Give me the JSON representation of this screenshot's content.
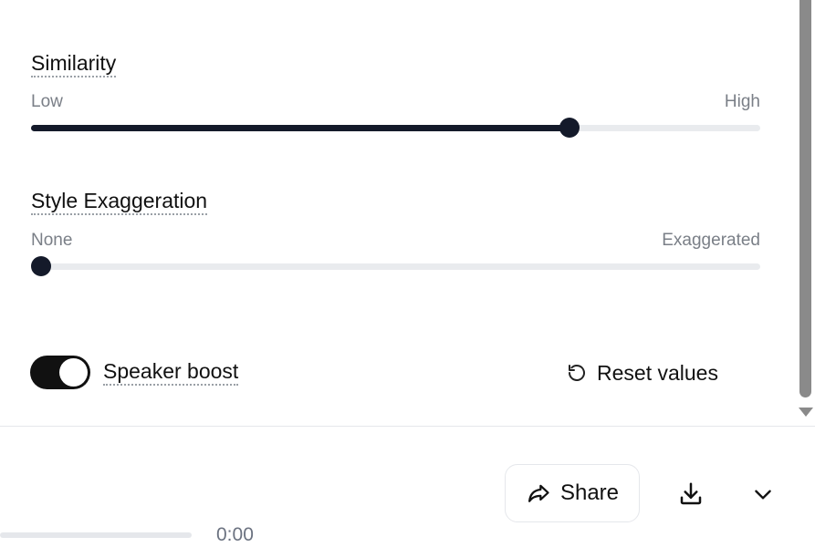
{
  "similarity": {
    "label": "Similarity",
    "low_label": "Low",
    "high_label": "High",
    "value": 0.745
  },
  "style_exaggeration": {
    "label": "Style Exaggeration",
    "low_label": "None",
    "high_label": "Exaggerated",
    "value": 0.0
  },
  "speaker_boost": {
    "label": "Speaker boost",
    "enabled": true
  },
  "reset": {
    "label": "Reset values",
    "icon": "reset-icon"
  },
  "player": {
    "time": "0:00",
    "share_label": "Share",
    "share_icon": "share-icon",
    "download_icon": "download-icon",
    "more_icon": "chevron-down-icon"
  },
  "colors": {
    "accent": "#141a2a",
    "track": "#e9ebee",
    "toggle_on": "#111111"
  }
}
